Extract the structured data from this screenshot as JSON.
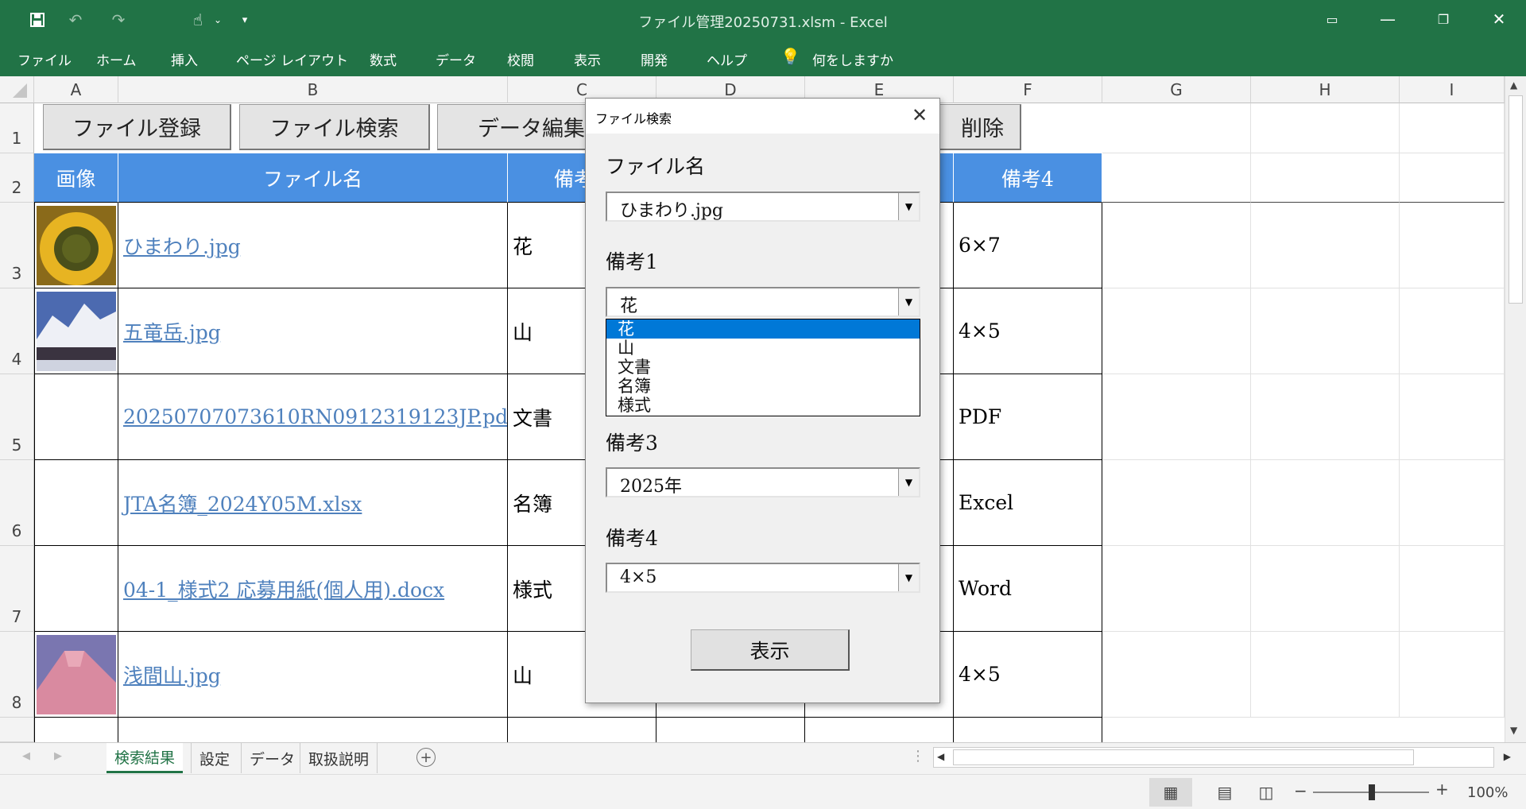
{
  "app": {
    "window_title": "ファイル管理20250731.xlsm  -  Excel"
  },
  "ribbon": {
    "tabs": [
      "ファイル",
      "ホーム",
      "挿入",
      "ページ レイアウト",
      "数式",
      "データ",
      "校閲",
      "表示",
      "開発",
      "ヘルプ"
    ],
    "tell_me": "何をしますか"
  },
  "columns": [
    "A",
    "B",
    "C",
    "D",
    "E",
    "F",
    "G",
    "H",
    "I"
  ],
  "rows": [
    "1",
    "2",
    "3",
    "4",
    "5",
    "6",
    "7",
    "8"
  ],
  "buttons": {
    "register": "ファイル登録",
    "search": "ファイル検索",
    "edit": "データ編集",
    "delete": "削除"
  },
  "table": {
    "headers": {
      "image": "画像",
      "filename": "ファイル名",
      "note1": "備考",
      "note4": "備考4"
    },
    "rows": [
      {
        "filename": "ひまわり.jpg",
        "note1": "花",
        "note4": "6×7"
      },
      {
        "filename": "五竜岳.jpg",
        "note1": "山",
        "note4": "4×5"
      },
      {
        "filename": "20250707073610RN0912319123JP.pdf",
        "note1": "文書",
        "note4": "PDF"
      },
      {
        "filename": "JTA名簿_2024Y05M.xlsx",
        "note1": "名簿",
        "note4": "Excel"
      },
      {
        "filename": "04-1_様式2 応募用紙(個人用).docx",
        "note1": "様式",
        "note4": "Word"
      },
      {
        "filename": "浅間山.jpg",
        "note1": "山",
        "note4": "4×5"
      }
    ]
  },
  "dialog": {
    "title": "ファイル検索",
    "filename_label": "ファイル名",
    "filename_value": "ひまわり.jpg",
    "note1_label": "備考1",
    "note1_value": "花",
    "note1_options": [
      "花",
      "山",
      "文書",
      "名簿",
      "様式"
    ],
    "note3_label": "備考3",
    "note3_value": "2025年",
    "note4_label": "備考4",
    "note4_value": "4×5",
    "show_button": "表示"
  },
  "sheet_tabs": [
    "検索結果",
    "設定",
    "データ",
    "取扱説明"
  ],
  "status": {
    "zoom": "100%"
  },
  "colors": {
    "excel_green": "#217346",
    "header_blue": "#4a90e2",
    "selection_blue": "#0078d7"
  }
}
